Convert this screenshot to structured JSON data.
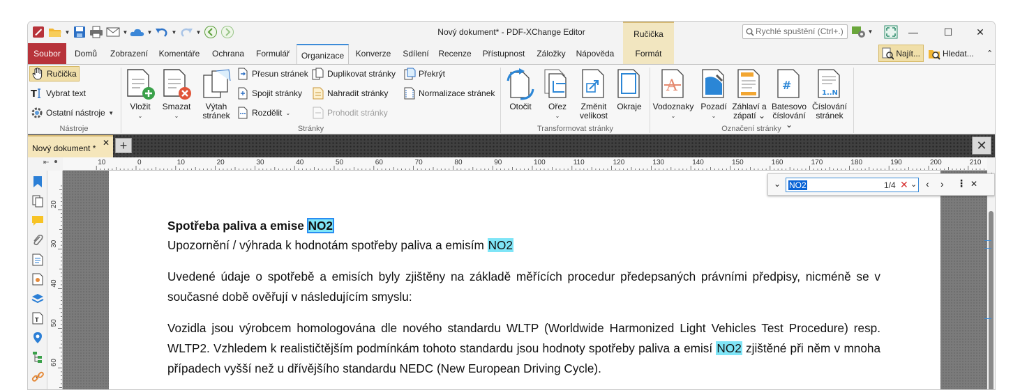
{
  "window": {
    "title": "Nový dokument* - PDF-XChange Editor",
    "quick_launch_placeholder": "Rychlé spuštění (Ctrl+.)"
  },
  "context_tab": {
    "group": "Ručička",
    "tab": "Formát"
  },
  "tabs": [
    "Soubor",
    "Domů",
    "Zobrazení",
    "Komentáře",
    "Ochrana",
    "Formulář",
    "Organizace",
    "Konverze",
    "Sdílení",
    "Recenze",
    "Přístupnost",
    "Záložky",
    "Nápověda"
  ],
  "active_tab": "Organizace",
  "right_buttons": {
    "find": "Najít...",
    "search": "Hledat..."
  },
  "ribbon": {
    "tools": {
      "hand": "Ručička",
      "select_text": "Vybrat text",
      "other_tools": "Ostatní nástroje",
      "group_label": "Nástroje"
    },
    "pages": {
      "insert": "Vložit",
      "delete": "Smazat",
      "extract": "Výtah stránek",
      "move": "Přesun stránek",
      "merge": "Spojit stránky",
      "split": "Rozdělit",
      "duplicate": "Duplikovat stránky",
      "replace": "Nahradit stránky",
      "swap": "Prohodit stránky",
      "overlay": "Překrýt",
      "normalize": "Normalizace stránek",
      "group_label": "Stránky"
    },
    "transform": {
      "rotate": "Otočit",
      "crop": "Ořez",
      "resize_1": "Změnit",
      "resize_2": "velikost",
      "margins": "Okraje",
      "group_label": "Transformovat stránky"
    },
    "marking": {
      "watermarks": "Vodoznaky",
      "background": "Pozadí",
      "header_1": "Záhlaví a",
      "header_2": "zápatí",
      "bates_1": "Batesovo",
      "bates_2": "číslování",
      "numbering_1": "Číslování",
      "numbering_2": "stránek",
      "group_label": "Označení stránky"
    }
  },
  "doc_tab": {
    "title": "Nový dokument *"
  },
  "find": {
    "query": "NO2",
    "count": "1/4"
  },
  "ruler": {
    "h_ticks": [
      "10",
      "0",
      "10",
      "20",
      "30",
      "40",
      "50",
      "60",
      "70",
      "80",
      "90",
      "100",
      "110",
      "120",
      "130",
      "140",
      "150",
      "160",
      "170",
      "180",
      "190",
      "200",
      "210",
      "220"
    ],
    "v_ticks": [
      "20",
      "30",
      "40",
      "50",
      "60"
    ]
  },
  "document": {
    "heading": "Spotřeba paliva a emise",
    "term": "NO2",
    "line2": "Upozornění / výhrada k hodnotám spotřeby paliva a emisím",
    "para1": "Uvedené údaje o spotřebě a emisích byly zjištěny na základě měřících procedur předepsaných právními předpisy, nicméně se v současné době ověřují v následujícím smyslu:",
    "para2_a": "Vozidla jsou výrobcem homologována dle nového standardu WLTP (Worldwide Harmonized Light Vehicles Test Procedure) resp. WLTP2. Vzhledem k realističtějším podmínkám tohoto standardu jsou hodnoty spotřeby paliva a emisí",
    "para2_b": "zjištěné při něm v mnoha případech vyšší než u dřívějšího standardu NEDC (New European Driving Cycle)."
  },
  "colors": {
    "file_tab": "#b7333a",
    "accent": "#3c8bd8",
    "highlight": "#7fe5f7",
    "context": "#f2e6c0"
  }
}
